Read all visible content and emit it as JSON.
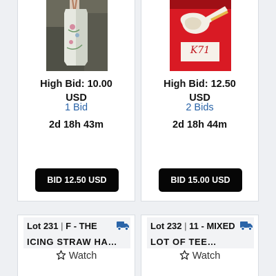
{
  "listings": [
    {
      "image_alt": "hexagonal porcelain vase with floral decoration",
      "high_bid": "High Bid: 10.00",
      "currency": "USD",
      "bids": "1 Bid",
      "time_left": "2d 18h 43m",
      "bid_button": "BID 12.50 USD"
    },
    {
      "image_alt": "carved white pipe on red background",
      "image_label": "K71",
      "high_bid": "High Bid: 12.50",
      "currency": "USD",
      "bids": "2 Bids",
      "time_left": "2d 18h 44m",
      "bid_button": "BID 15.00 USD"
    }
  ],
  "lots": [
    {
      "lot_label": "Lot 231",
      "separator": "|",
      "title_part1": "F - THE",
      "title_part2": "ICING STRAW HA…",
      "watch": "Watch",
      "icon": "shipping-truck-icon"
    },
    {
      "lot_label": "Lot 232",
      "separator": "|",
      "title_part1": "11 - MIXED",
      "title_part2": "LOT OF TEE…",
      "watch": "Watch",
      "icon": "shipping-truck-icon"
    }
  ],
  "colors": {
    "link": "#2a64a8",
    "button": "#060606",
    "truck": "#2a64a8"
  }
}
